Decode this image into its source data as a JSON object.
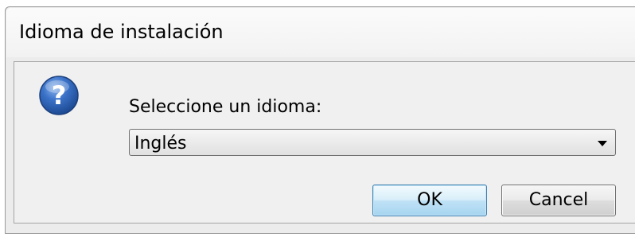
{
  "window": {
    "title": "Idioma de instalación"
  },
  "content": {
    "icon": "question-icon",
    "prompt": "Seleccione un idioma:",
    "language_select": {
      "selected": "Inglés"
    }
  },
  "buttons": {
    "ok": "OK",
    "cancel": "Cancel"
  },
  "colors": {
    "icon_blue": "#2b5fb3",
    "ok_border": "#3c7fb1"
  }
}
